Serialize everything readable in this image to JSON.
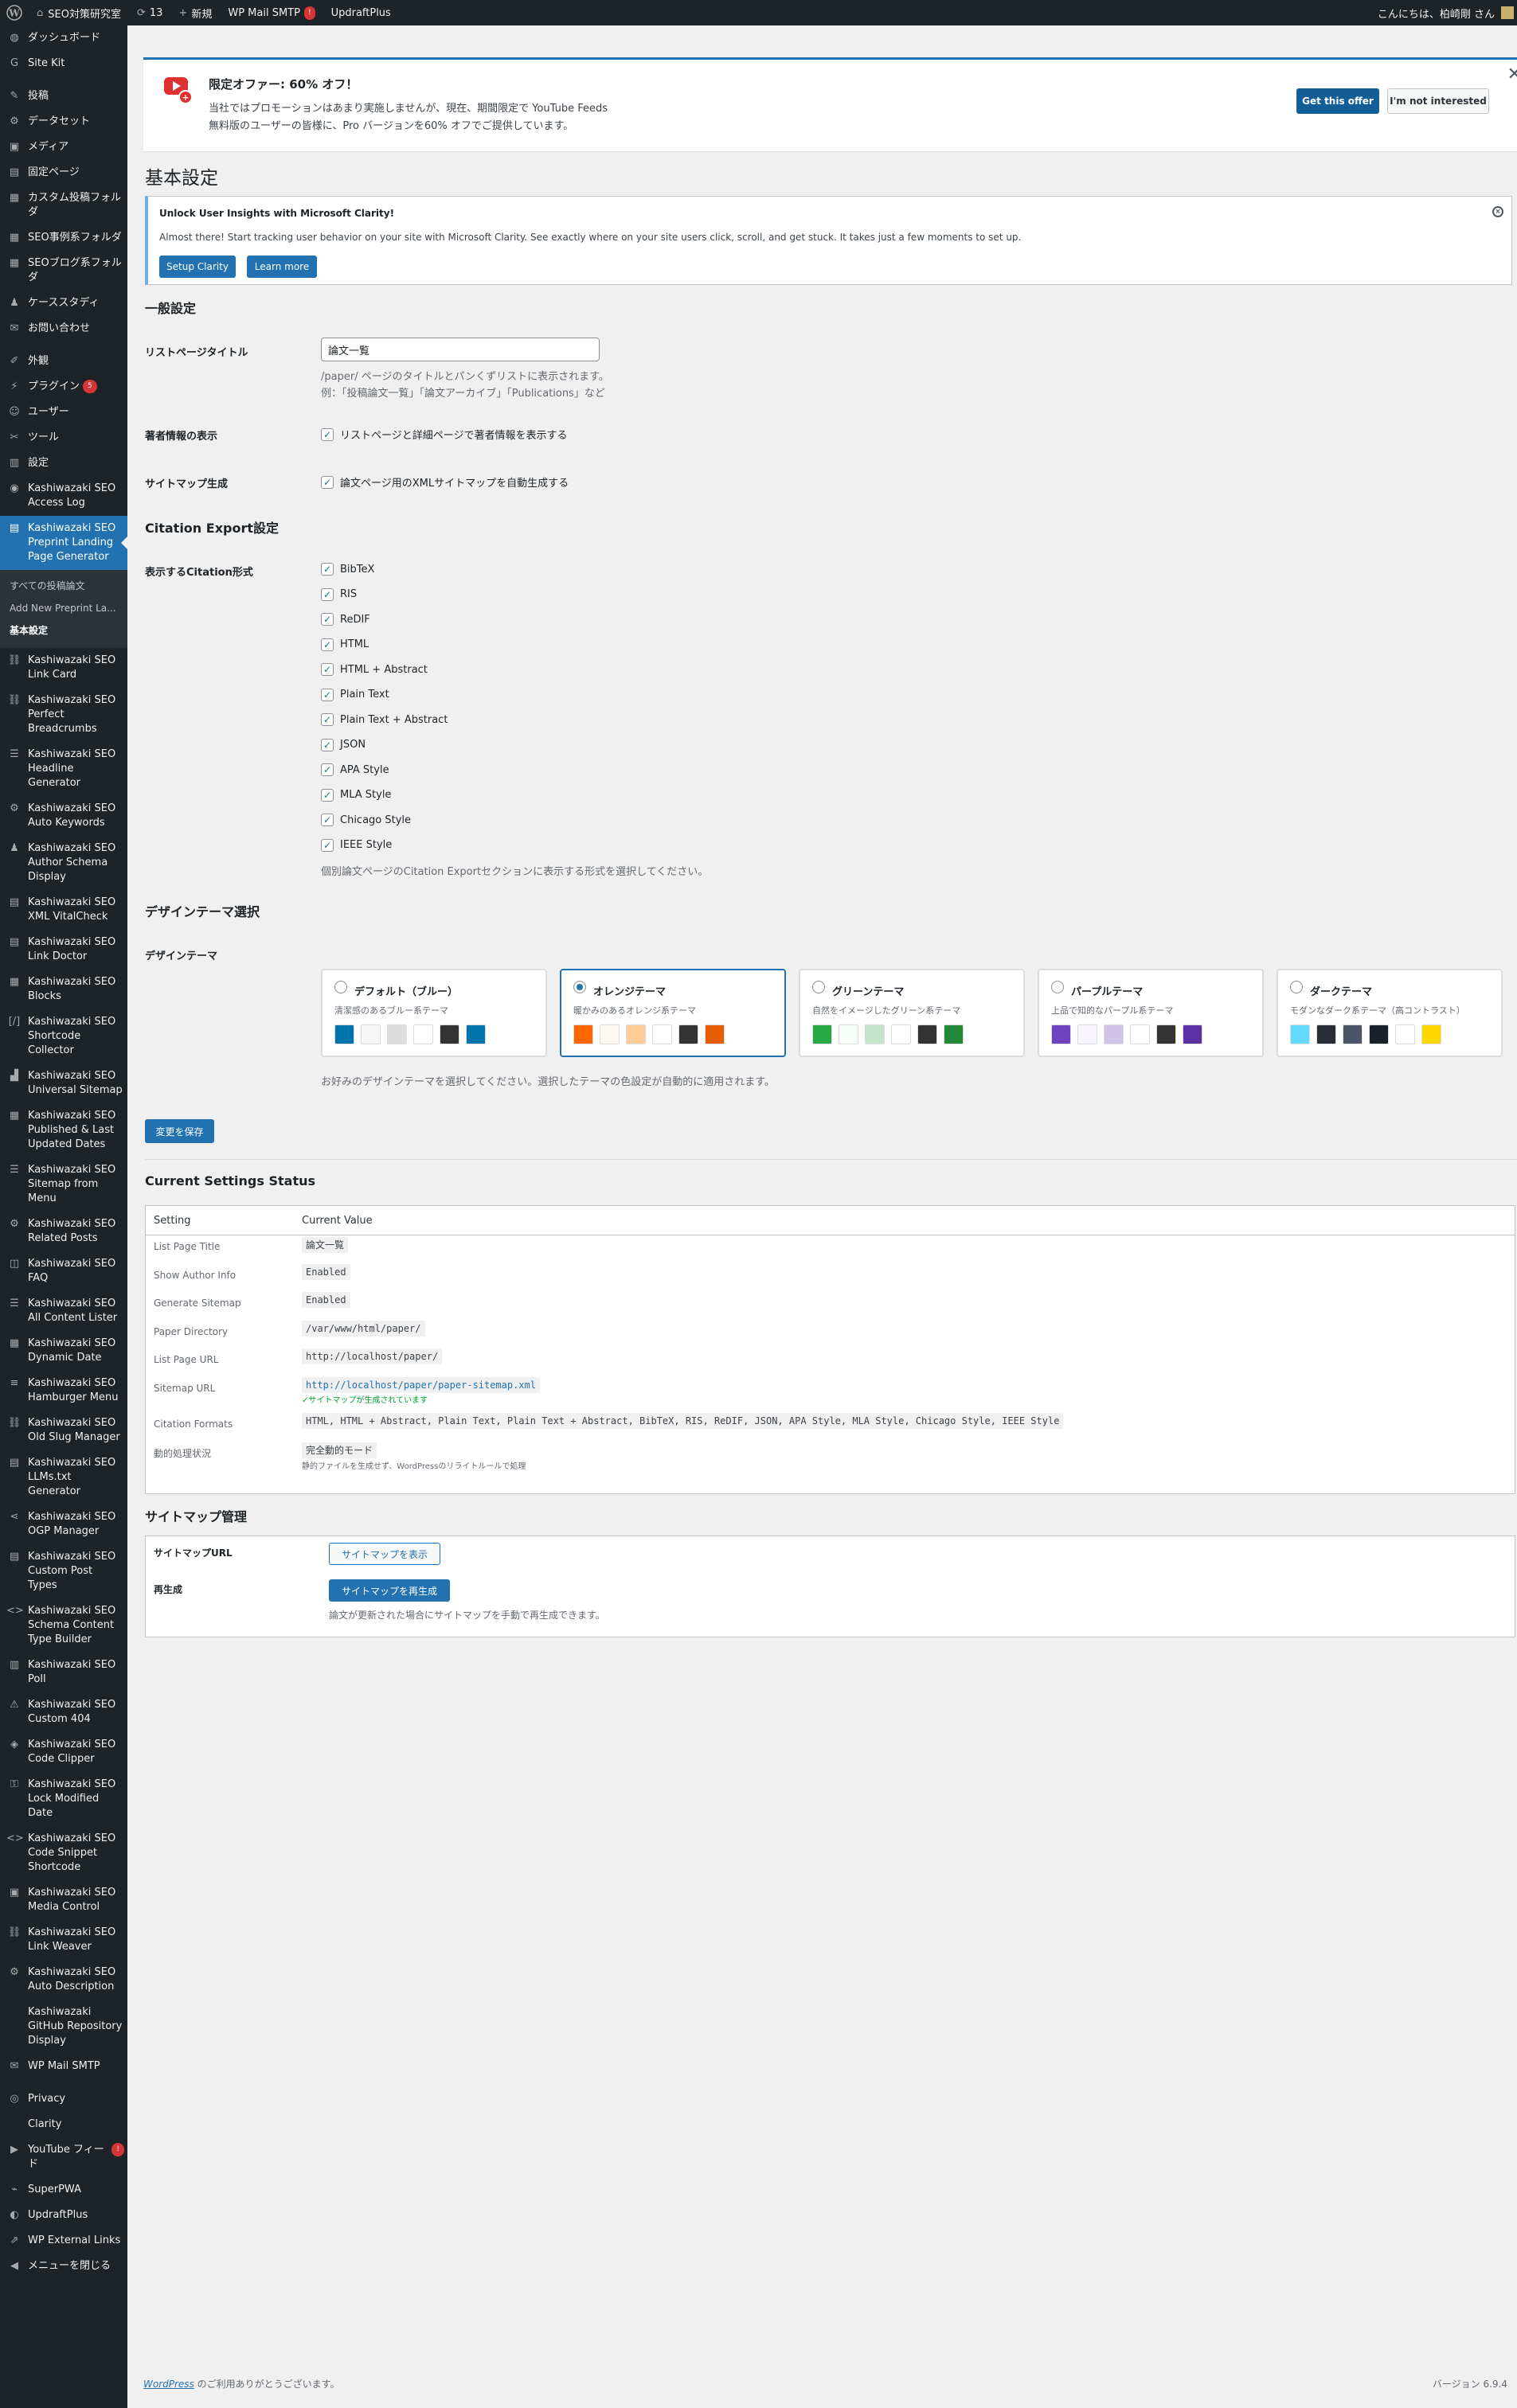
{
  "admin_bar": {
    "site_name": "SEO対策研究室",
    "updates_count": "13",
    "new_label": "新規",
    "smtp_label": "WP Mail SMTP",
    "smtp_badge": "!",
    "updraft_label": "UpdraftPlus",
    "greeting": "こんにちは、柏崎剛 さん"
  },
  "sidebar": {
    "items": [
      {
        "label": "ダッシュボード",
        "icon": "dashboard-icon",
        "glyph": "◍"
      },
      {
        "label": "Site Kit",
        "icon": "sitekit-icon",
        "glyph": "G"
      },
      {
        "label": "投稿",
        "icon": "pin-icon",
        "glyph": "✎"
      },
      {
        "label": "データセット",
        "icon": "gear-icon",
        "glyph": "⚙"
      },
      {
        "label": "メディア",
        "icon": "media-icon",
        "glyph": "▣"
      },
      {
        "label": "固定ページ",
        "icon": "page-icon",
        "glyph": "▤"
      },
      {
        "label": "カスタム投稿フォルダ",
        "icon": "folder-icon",
        "glyph": "▦"
      },
      {
        "label": "SEO事例系フォルダ",
        "icon": "folder-icon",
        "glyph": "▦"
      },
      {
        "label": "SEOブログ系フォルダ",
        "icon": "folder-icon",
        "glyph": "▦"
      },
      {
        "label": "ケーススタディ",
        "icon": "person-icon",
        "glyph": "♟"
      },
      {
        "label": "お問い合わせ",
        "icon": "mail-icon",
        "glyph": "✉"
      },
      {
        "label": "外観",
        "icon": "brush-icon",
        "glyph": "✐"
      },
      {
        "label": "プラグイン",
        "icon": "plugin-icon",
        "glyph": "⚡",
        "badge": "5"
      },
      {
        "label": "ユーザー",
        "icon": "user-icon",
        "glyph": "☺"
      },
      {
        "label": "ツール",
        "icon": "wrench-icon",
        "glyph": "✂"
      },
      {
        "label": "設定",
        "icon": "settings-icon",
        "glyph": "▥"
      },
      {
        "label": "Kashiwazaki SEO Access Log",
        "icon": "eye-icon",
        "glyph": "◉"
      },
      {
        "label": "Kashiwazaki SEO Preprint Landing Page Generator",
        "icon": "document-icon",
        "glyph": "▤"
      },
      {
        "label": "Kashiwazaki SEO Link Card",
        "icon": "link-icon",
        "glyph": "⛓"
      },
      {
        "label": "Kashiwazaki SEO Perfect Breadcrumbs",
        "icon": "link-icon",
        "glyph": "⛓"
      },
      {
        "label": "Kashiwazaki SEO Headline Generator",
        "icon": "list-icon",
        "glyph": "☰"
      },
      {
        "label": "Kashiwazaki SEO Auto Keywords",
        "icon": "gear-icon",
        "glyph": "⚙"
      },
      {
        "label": "Kashiwazaki SEO Author Schema Display",
        "icon": "person-icon",
        "glyph": "♟"
      },
      {
        "label": "Kashiwazaki SEO XML VitalCheck",
        "icon": "code-icon",
        "glyph": "▤"
      },
      {
        "label": "Kashiwazaki SEO Link Doctor",
        "icon": "code-icon",
        "glyph": "▤"
      },
      {
        "label": "Kashiwazaki SEO Blocks",
        "icon": "blocks-icon",
        "glyph": "▦"
      },
      {
        "label": "Kashiwazaki SEO Shortcode Collector",
        "icon": "shortcode-icon",
        "glyph": "[/]"
      },
      {
        "label": "Kashiwazaki SEO Universal Sitemap",
        "icon": "chart-icon",
        "glyph": "▟"
      },
      {
        "label": "Kashiwazaki SEO Published & Last Updated Dates",
        "icon": "calendar-icon",
        "glyph": "▦"
      },
      {
        "label": "Kashiwazaki SEO Sitemap from Menu",
        "icon": "list-icon",
        "glyph": "☰"
      },
      {
        "label": "Kashiwazaki SEO Related Posts",
        "icon": "gear-icon",
        "glyph": "⚙"
      },
      {
        "label": "Kashiwazaki SEO FAQ",
        "icon": "faq-icon",
        "glyph": "◫"
      },
      {
        "label": "Kashiwazaki SEO All Content Lister",
        "icon": "list-icon",
        "glyph": "☰"
      },
      {
        "label": "Kashiwazaki SEO Dynamic Date",
        "icon": "calendar-icon",
        "glyph": "▦"
      },
      {
        "label": "Kashiwazaki SEO Hamburger Menu",
        "icon": "menu-icon",
        "glyph": "≡"
      },
      {
        "label": "Kashiwazaki SEO Old Slug Manager",
        "icon": "link-icon",
        "glyph": "⛓"
      },
      {
        "label": "Kashiwazaki SEO LLMs.txt Generator",
        "icon": "document-icon",
        "glyph": "▤"
      },
      {
        "label": "Kashiwazaki SEO OGP Manager",
        "icon": "share-icon",
        "glyph": "⋖"
      },
      {
        "label": "Kashiwazaki SEO Custom Post Types",
        "icon": "document-icon",
        "glyph": "▤"
      },
      {
        "label": "Kashiwazaki SEO Schema Content Type Builder",
        "icon": "code-brackets-icon",
        "glyph": "<>"
      },
      {
        "label": "Kashiwazaki SEO Poll",
        "icon": "poll-icon",
        "glyph": "▥"
      },
      {
        "label": "Kashiwazaki SEO Custom 404",
        "icon": "warning-icon",
        "glyph": "⚠"
      },
      {
        "label": "Kashiwazaki SEO Code Clipper",
        "icon": "tag-icon",
        "glyph": "◈"
      },
      {
        "label": "Kashiwazaki SEO Lock Modified Date",
        "icon": "lock-icon",
        "glyph": "⚿"
      },
      {
        "label": "Kashiwazaki SEO Code Snippet Shortcode",
        "icon": "code-brackets-icon",
        "glyph": "<>"
      },
      {
        "label": "Kashiwazaki SEO Media Control",
        "icon": "media-icon",
        "glyph": "▣"
      },
      {
        "label": "Kashiwazaki SEO Link Weaver",
        "icon": "link-icon",
        "glyph": "⛓"
      },
      {
        "label": "Kashiwazaki SEO Auto Description",
        "icon": "gear-icon",
        "glyph": "⚙"
      },
      {
        "label": "Kashiwazaki GitHub Repository Display",
        "icon": "github-icon",
        "glyph": ""
      },
      {
        "label": "WP Mail SMTP",
        "icon": "mail-icon",
        "glyph": "✉"
      },
      {
        "label": "Privacy",
        "icon": "privacy-icon",
        "glyph": "◎"
      },
      {
        "label": "Clarity",
        "icon": "clarity-icon",
        "glyph": ""
      },
      {
        "label": "YouTube フィード",
        "icon": "youtube-icon",
        "glyph": "▶",
        "badge": "!"
      },
      {
        "label": "SuperPWA",
        "icon": "superpwa-icon",
        "glyph": "⌁"
      },
      {
        "label": "UpdraftPlus",
        "icon": "updraft-icon",
        "glyph": "◐"
      },
      {
        "label": "WP External Links",
        "icon": "external-link-icon",
        "glyph": "⇗"
      },
      {
        "label": "メニューを閉じる",
        "icon": "collapse-icon",
        "glyph": "◀"
      }
    ],
    "submenu": [
      "すべての投稿論文",
      "Add New Preprint La...",
      "基本設定"
    ]
  },
  "promo": {
    "title": "限定オファー: 60% オフ！",
    "line1": "当社ではプロモーションはあまり実施しませんが、現在、期間限定で YouTube Feeds",
    "line2": "無料版のユーザーの皆様に、Pro バージョンを60% オフでご提供しています。",
    "cta": "Get this offer",
    "dismiss": "I'm not interested"
  },
  "page_title": "基本設定",
  "clarity": {
    "title": "Unlock User Insights with Microsoft Clarity!",
    "desc": "Almost there! Start tracking user behavior on your site with Microsoft Clarity. See exactly where on your site users click, scroll, and get stuck. It takes just a few moments to set up.",
    "setup": "Setup Clarity",
    "learn": "Learn more"
  },
  "general": {
    "heading": "一般設定",
    "list_title_label": "リストページタイトル",
    "list_title_value": "論文一覧",
    "list_title_desc1": "/paper/ ページのタイトルとパンくずリストに表示されます。",
    "list_title_desc2": "例：「投稿論文一覧」「論文アーカイブ」「Publications」など",
    "author_label": "著者情報の表示",
    "author_cb": "リストページと詳細ページで著者情報を表示する",
    "sitemap_label": "サイトマップ生成",
    "sitemap_cb": "論文ページ用のXMLサイトマップを自動生成する"
  },
  "citation": {
    "heading": "Citation Export設定",
    "label": "表示するCitation形式",
    "formats": [
      "BibTeX",
      "RIS",
      "ReDIF",
      "HTML",
      "HTML + Abstract",
      "Plain Text",
      "Plain Text + Abstract",
      "JSON",
      "APA Style",
      "MLA Style",
      "Chicago Style",
      "IEEE Style"
    ],
    "desc": "個別論文ページのCitation Exportセクションに表示する形式を選択してください。"
  },
  "design": {
    "heading": "デザインテーマ選択",
    "label": "デザインテーマ",
    "themes": [
      {
        "name": "デフォルト（ブルー）",
        "desc": "清潔感のあるブルー系テーマ",
        "selected": false,
        "colors": [
          "#0073aa",
          "#f7f7f7",
          "#dddddd",
          "#ffffff",
          "#333333",
          "#0073aa"
        ]
      },
      {
        "name": "オレンジテーマ",
        "desc": "暖かみのあるオレンジ系テーマ",
        "selected": true,
        "colors": [
          "#ff6600",
          "#fff8f0",
          "#ffcc99",
          "#ffffff",
          "#333333",
          "#e65c00"
        ]
      },
      {
        "name": "グリーンテーマ",
        "desc": "自然をイメージしたグリーン系テーマ",
        "selected": false,
        "colors": [
          "#28a745",
          "#f8fff9",
          "#c3e6cb",
          "#ffffff",
          "#333333",
          "#218838"
        ]
      },
      {
        "name": "パープルテーマ",
        "desc": "上品で知的なパープル系テーマ",
        "selected": false,
        "colors": [
          "#6f42c1",
          "#f8f5ff",
          "#d1c4e9",
          "#ffffff",
          "#333333",
          "#5a32a3"
        ]
      },
      {
        "name": "ダークテーマ",
        "desc": "モダンなダーク系テーマ（高コントラスト）",
        "selected": false,
        "colors": [
          "#61dafb",
          "#282c34",
          "#4a5568",
          "#1a202c",
          "#ffffff",
          "#ffd700"
        ]
      }
    ],
    "desc": "お好みのデザインテーマを選択してください。選択したテーマの色設定が自動的に適用されます。"
  },
  "save_label": "変更を保存",
  "status": {
    "heading": "Current Settings Status",
    "col_setting": "Setting",
    "col_value": "Current Value",
    "rows": [
      {
        "k": "List Page Title",
        "v": "論文一覧"
      },
      {
        "k": "Show Author Info",
        "v": "Enabled"
      },
      {
        "k": "Generate Sitemap",
        "v": "Enabled"
      },
      {
        "k": "Paper Directory",
        "v": "/var/www/html/paper/"
      },
      {
        "k": "List Page URL",
        "v": "http://localhost/paper/"
      },
      {
        "k": "Sitemap URL",
        "v": "http://localhost/paper/paper-sitemap.xml",
        "note": "✓サイトマップが生成されています"
      },
      {
        "k": "Citation Formats",
        "v": "HTML, HTML + Abstract, Plain Text, Plain Text + Abstract, BibTeX, RIS, ReDIF, JSON, APA Style, MLA Style, Chicago Style, IEEE Style"
      },
      {
        "k": "動的処理状況",
        "v": "完全動的モード",
        "note": "静的ファイルを生成せず、WordPressのリライトルールで処理"
      }
    ]
  },
  "sitemap_mgmt": {
    "heading": "サイトマップ管理",
    "url_label": "サイトマップURL",
    "show_btn": "サイトマップを表示",
    "regen_label": "再生成",
    "regen_btn": "サイトマップを再生成",
    "regen_desc": "論文が更新された場合にサイトマップを手動で再生成できます。"
  },
  "footer": {
    "wp": "WordPress",
    "thanks": " のご利用ありがとうございます。",
    "version": "バージョン 6.9.4"
  }
}
